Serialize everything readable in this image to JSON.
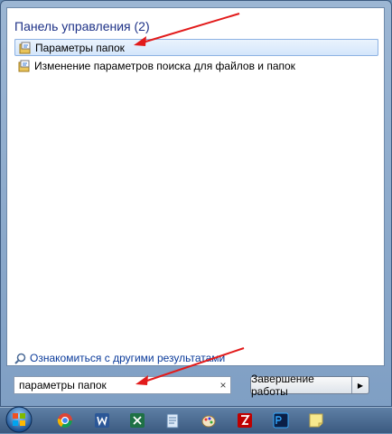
{
  "control_panel": {
    "title": "Панель управления (2)",
    "items": [
      {
        "label": "Параметры папок",
        "selected": true
      },
      {
        "label": "Изменение параметров поиска для файлов и папок",
        "selected": false
      }
    ]
  },
  "more_results": {
    "label": "Ознакомиться с другими результатами"
  },
  "search": {
    "value": "параметры папок",
    "clear_glyph": "×"
  },
  "shutdown": {
    "label": "Завершение работы",
    "arrow_glyph": "▶"
  },
  "taskbar": {
    "icons": [
      "chrome-icon",
      "word-icon",
      "excel-icon",
      "notepad-icon",
      "paint-icon",
      "filezilla-icon",
      "photoshop-icon",
      "sticky-notes-icon"
    ]
  },
  "colors": {
    "accent_title": "#1e3287",
    "annotation_arrow": "#e21b1b",
    "selection": "#d4e6fb"
  }
}
